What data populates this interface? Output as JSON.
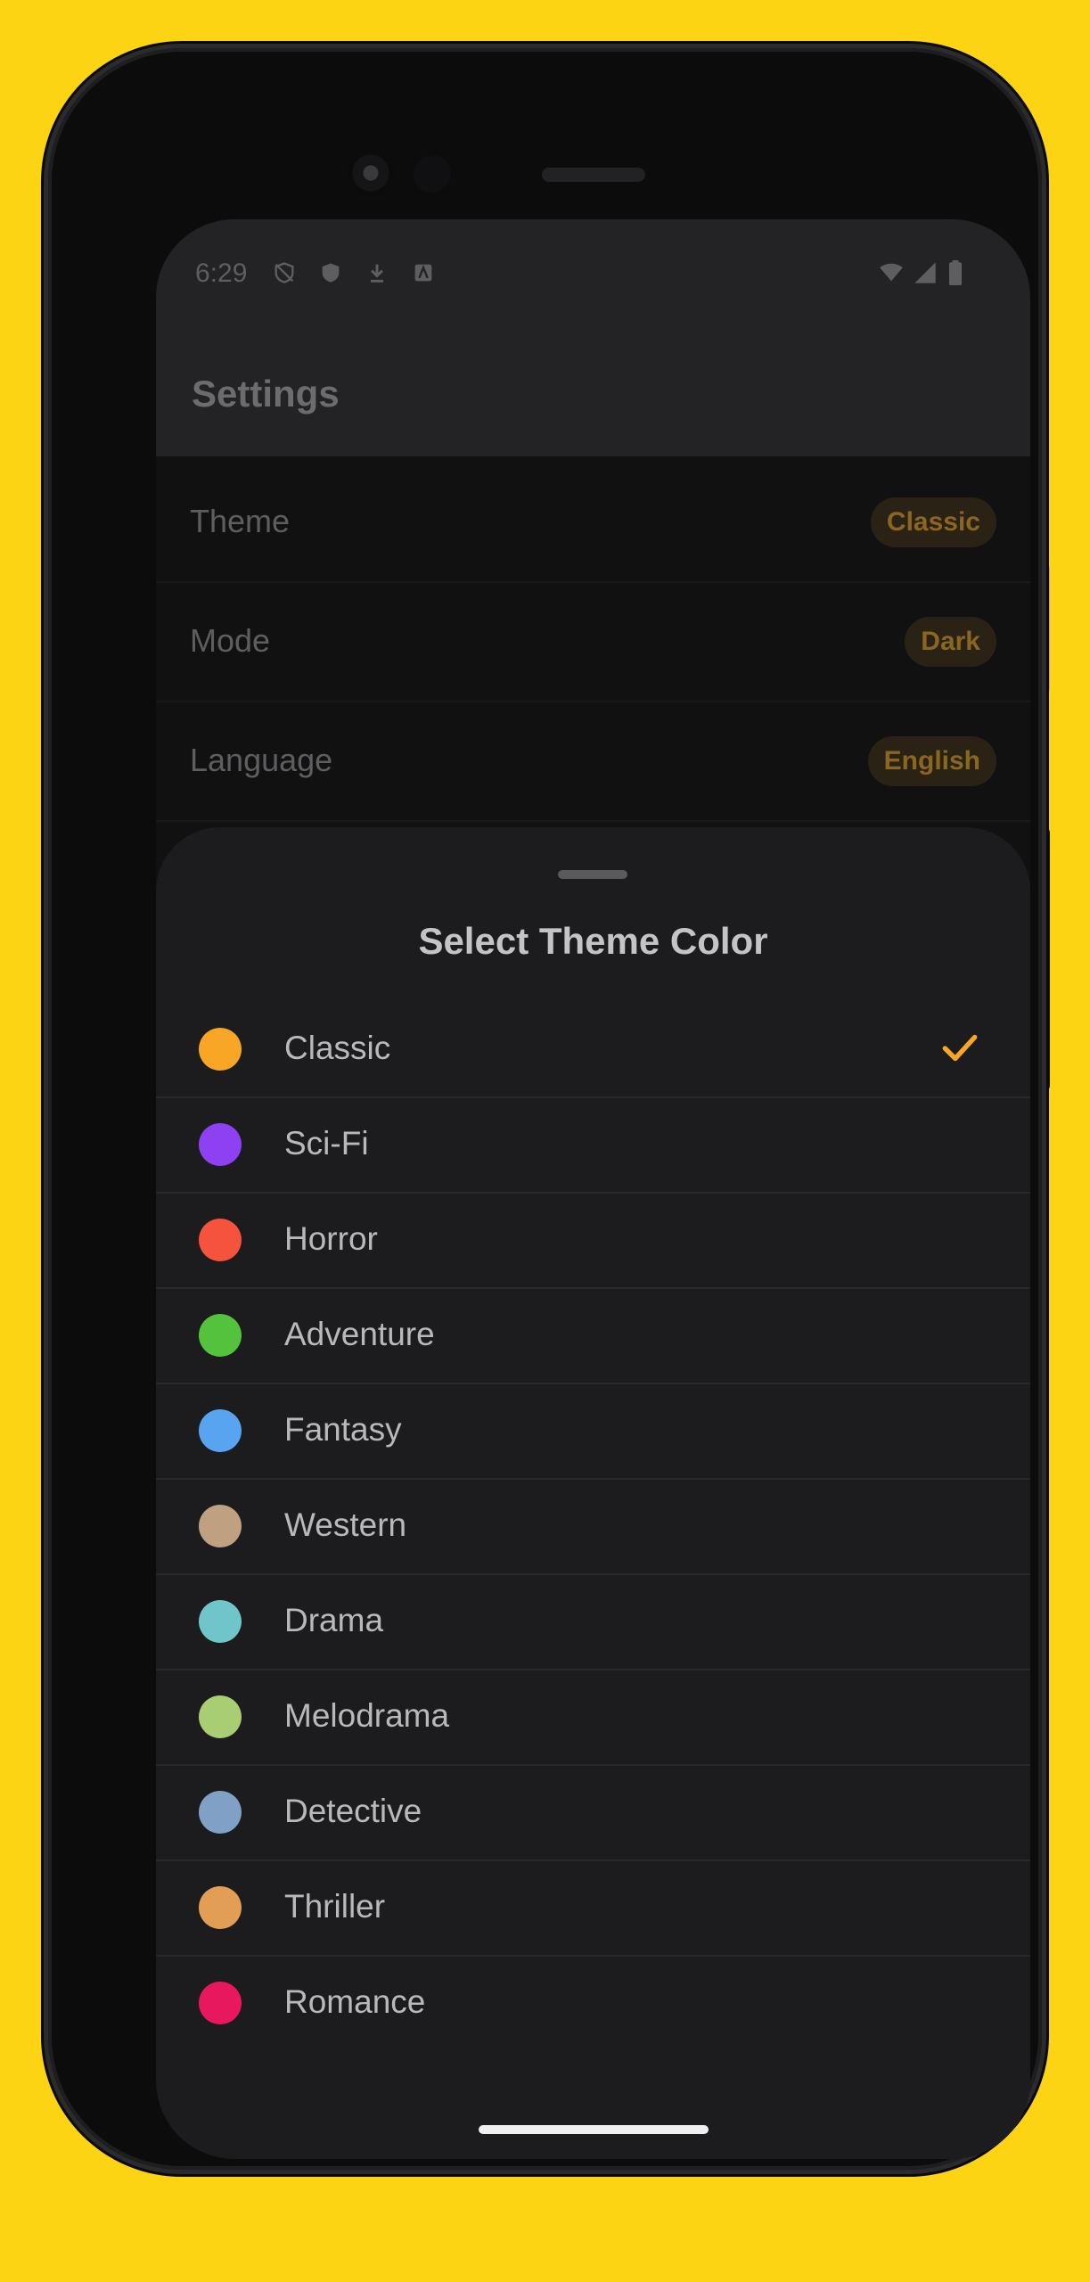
{
  "status_bar": {
    "time": "6:29"
  },
  "app_bar": {
    "title": "Settings"
  },
  "settings": [
    {
      "label": "Theme",
      "value": "Classic"
    },
    {
      "label": "Mode",
      "value": "Dark"
    },
    {
      "label": "Language",
      "value": "English"
    }
  ],
  "sheet": {
    "title": "Select Theme Color",
    "selected": "Classic",
    "options": [
      {
        "label": "Classic",
        "color": "#F7A626"
      },
      {
        "label": "Sci-Fi",
        "color": "#8E40F3"
      },
      {
        "label": "Horror",
        "color": "#F5533D"
      },
      {
        "label": "Adventure",
        "color": "#55C23D"
      },
      {
        "label": "Fantasy",
        "color": "#58A4F0"
      },
      {
        "label": "Western",
        "color": "#BFA182"
      },
      {
        "label": "Drama",
        "color": "#70C5CB"
      },
      {
        "label": "Melodrama",
        "color": "#A9CD72"
      },
      {
        "label": "Detective",
        "color": "#80A0C6"
      },
      {
        "label": "Thriller",
        "color": "#E39E55"
      },
      {
        "label": "Romance",
        "color": "#E8185F"
      }
    ]
  },
  "colors": {
    "accent": "#F7A626",
    "background": "#FDD413",
    "sheet": "#1C1C1E"
  }
}
